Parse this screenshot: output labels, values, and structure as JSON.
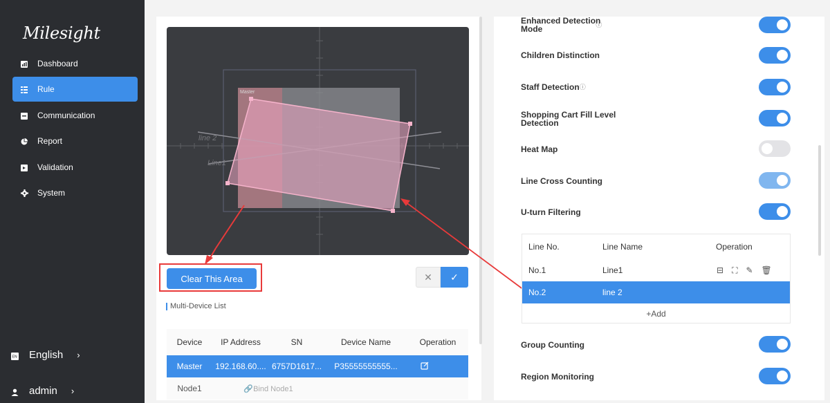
{
  "sidebar": {
    "brand": "Milesight",
    "items": [
      {
        "label": "Dashboard",
        "icon": "bar-chart-icon"
      },
      {
        "label": "Rule",
        "icon": "list-icon",
        "active": true
      },
      {
        "label": "Communication",
        "icon": "terminal-icon"
      },
      {
        "label": "Report",
        "icon": "pie-chart-icon"
      },
      {
        "label": "Validation",
        "icon": "check-icon"
      },
      {
        "label": "System",
        "icon": "gear-icon"
      }
    ],
    "language": "English",
    "user": "admin"
  },
  "canvas": {
    "master_label": "Master",
    "line_labels": [
      "line 2",
      "Line1"
    ]
  },
  "actions": {
    "clear_area": "Clear This Area",
    "cancel": "✕",
    "confirm": "✓"
  },
  "device_list": {
    "title": "Multi-Device List",
    "headers": [
      "Device",
      "IP Address",
      "SN",
      "Device Name",
      "Operation"
    ],
    "rows": [
      {
        "device": "Master",
        "ip": "192.168.60....",
        "sn": "6757D1617...",
        "name": "P35555555555..."
      },
      {
        "device": "Node1",
        "bind": "Bind Node1"
      }
    ]
  },
  "options": [
    {
      "label_l1": "Enhanced Detection",
      "label_l2": "Mode",
      "info": "ⓘ",
      "on": true
    },
    {
      "label": "Children Distinction",
      "on": true
    },
    {
      "label": "Staff Detection",
      "info": "ⓘ",
      "on": true
    },
    {
      "label_l1": "Shopping Cart Fill Level",
      "label_l2": "Detection",
      "on": true
    },
    {
      "label": "Heat Map",
      "on": false
    },
    {
      "label": "Line Cross Counting",
      "on": true
    },
    {
      "label": "U-turn Filtering",
      "on": true
    },
    {
      "label": "Group Counting",
      "on": true
    },
    {
      "label": "Region Monitoring",
      "on": true
    }
  ],
  "line_table": {
    "headers": [
      "Line No.",
      "Line Name",
      "Operation"
    ],
    "rows": [
      {
        "no": "No.1",
        "name": "Line1"
      },
      {
        "no": "No.2",
        "name": "line 2"
      }
    ],
    "add": "+Add"
  },
  "colors": {
    "accent": "#3d8ee9",
    "sidebar_bg": "#2b2d31",
    "annotation": "#e83a3a",
    "region_fill": "#f0a8c4"
  }
}
